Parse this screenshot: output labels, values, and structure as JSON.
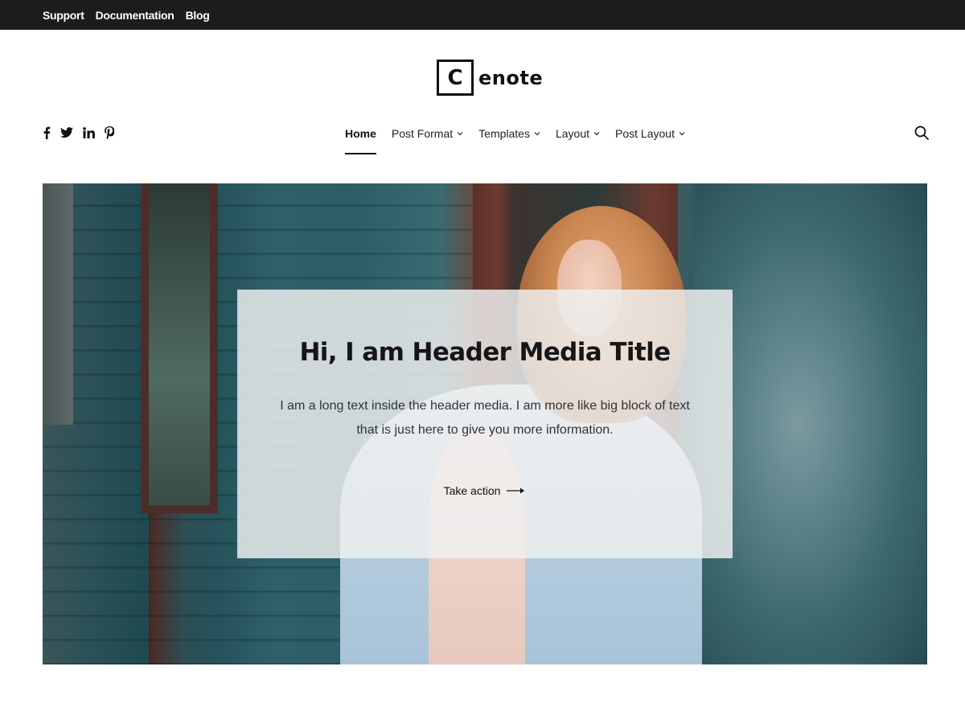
{
  "topbar": {
    "links": [
      {
        "label": "Support"
      },
      {
        "label": "Documentation"
      },
      {
        "label": "Blog"
      }
    ]
  },
  "logo": {
    "mark_letter": "C",
    "text": "enote"
  },
  "social": [
    {
      "name": "facebook-icon",
      "glyph": "f"
    },
    {
      "name": "twitter-icon"
    },
    {
      "name": "linkedin-icon",
      "glyph": "in"
    },
    {
      "name": "pinterest-icon"
    }
  ],
  "nav": {
    "items": [
      {
        "label": "Home",
        "active": true,
        "has_dropdown": false
      },
      {
        "label": "Post Format",
        "active": false,
        "has_dropdown": true
      },
      {
        "label": "Templates",
        "active": false,
        "has_dropdown": true
      },
      {
        "label": "Layout",
        "active": false,
        "has_dropdown": true
      },
      {
        "label": "Post Layout",
        "active": false,
        "has_dropdown": true
      }
    ],
    "search_icon": "search-icon"
  },
  "hero": {
    "title": "Hi, I am Header Media Title",
    "text": "I am a long text inside the header media. I am more like big block of text that is just here to give you more information.",
    "cta_label": "Take action",
    "cta_icon": "arrow-right-icon"
  },
  "colors": {
    "topbar_bg": "#1b1c1e",
    "text": "#111111",
    "overlay_bg": "#eef0f0"
  }
}
